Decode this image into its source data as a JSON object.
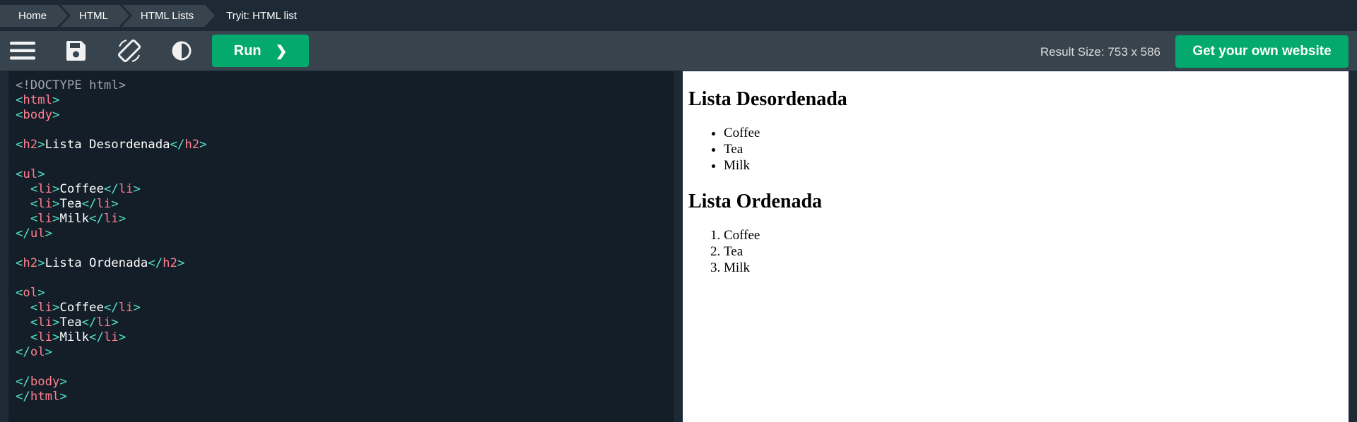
{
  "breadcrumb": {
    "items": [
      "Home",
      "HTML",
      "HTML Lists"
    ],
    "current": "Tryit: HTML list"
  },
  "toolbar": {
    "menu_icon": "hamburger-menu-icon",
    "save_icon": "floppy-disk-icon",
    "rotate_icon": "rotate-orientation-icon",
    "theme_icon": "contrast-icon",
    "run_label": "Run",
    "run_chevron": "❯",
    "result_size": "Result Size: 753 x 586",
    "get_website_label": "Get your own website"
  },
  "colors": {
    "background": "#1d2a35",
    "toolbar": "#38444d",
    "accent_green": "#04aa6d",
    "code_bg": "#141e28",
    "code_punct": "#52e5c6",
    "code_tag": "#ff7f8f"
  },
  "code": {
    "lines": [
      [
        {
          "t": "doct",
          "v": "<!DOCTYPE html>"
        }
      ],
      [
        {
          "t": "punc",
          "v": "<"
        },
        {
          "t": "tag",
          "v": "html"
        },
        {
          "t": "punc",
          "v": ">"
        }
      ],
      [
        {
          "t": "punc",
          "v": "<"
        },
        {
          "t": "tag",
          "v": "body"
        },
        {
          "t": "punc",
          "v": ">"
        }
      ],
      [],
      [
        {
          "t": "punc",
          "v": "<"
        },
        {
          "t": "tag",
          "v": "h2"
        },
        {
          "t": "punc",
          "v": ">"
        },
        {
          "t": "text",
          "v": "Lista Desordenada"
        },
        {
          "t": "punc",
          "v": "</"
        },
        {
          "t": "tag",
          "v": "h2"
        },
        {
          "t": "punc",
          "v": ">"
        }
      ],
      [],
      [
        {
          "t": "punc",
          "v": "<"
        },
        {
          "t": "tag",
          "v": "ul"
        },
        {
          "t": "punc",
          "v": ">"
        }
      ],
      [
        {
          "t": "text",
          "v": "  "
        },
        {
          "t": "punc",
          "v": "<"
        },
        {
          "t": "tag",
          "v": "li"
        },
        {
          "t": "punc",
          "v": ">"
        },
        {
          "t": "text",
          "v": "Coffee"
        },
        {
          "t": "punc",
          "v": "</"
        },
        {
          "t": "tag",
          "v": "li"
        },
        {
          "t": "punc",
          "v": ">"
        }
      ],
      [
        {
          "t": "text",
          "v": "  "
        },
        {
          "t": "punc",
          "v": "<"
        },
        {
          "t": "tag",
          "v": "li"
        },
        {
          "t": "punc",
          "v": ">"
        },
        {
          "t": "text",
          "v": "Tea"
        },
        {
          "t": "punc",
          "v": "</"
        },
        {
          "t": "tag",
          "v": "li"
        },
        {
          "t": "punc",
          "v": ">"
        }
      ],
      [
        {
          "t": "text",
          "v": "  "
        },
        {
          "t": "punc",
          "v": "<"
        },
        {
          "t": "tag",
          "v": "li"
        },
        {
          "t": "punc",
          "v": ">"
        },
        {
          "t": "text",
          "v": "Milk"
        },
        {
          "t": "punc",
          "v": "</"
        },
        {
          "t": "tag",
          "v": "li"
        },
        {
          "t": "punc",
          "v": ">"
        }
      ],
      [
        {
          "t": "punc",
          "v": "</"
        },
        {
          "t": "tag",
          "v": "ul"
        },
        {
          "t": "punc",
          "v": ">"
        }
      ],
      [],
      [
        {
          "t": "punc",
          "v": "<"
        },
        {
          "t": "tag",
          "v": "h2"
        },
        {
          "t": "punc",
          "v": ">"
        },
        {
          "t": "text",
          "v": "Lista Ordenada"
        },
        {
          "t": "punc",
          "v": "</"
        },
        {
          "t": "tag",
          "v": "h2"
        },
        {
          "t": "punc",
          "v": ">"
        }
      ],
      [],
      [
        {
          "t": "punc",
          "v": "<"
        },
        {
          "t": "tag",
          "v": "ol"
        },
        {
          "t": "punc",
          "v": ">"
        }
      ],
      [
        {
          "t": "text",
          "v": "  "
        },
        {
          "t": "punc",
          "v": "<"
        },
        {
          "t": "tag",
          "v": "li"
        },
        {
          "t": "punc",
          "v": ">"
        },
        {
          "t": "text",
          "v": "Coffee"
        },
        {
          "t": "punc",
          "v": "</"
        },
        {
          "t": "tag",
          "v": "li"
        },
        {
          "t": "punc",
          "v": ">"
        }
      ],
      [
        {
          "t": "text",
          "v": "  "
        },
        {
          "t": "punc",
          "v": "<"
        },
        {
          "t": "tag",
          "v": "li"
        },
        {
          "t": "punc",
          "v": ">"
        },
        {
          "t": "text",
          "v": "Tea"
        },
        {
          "t": "punc",
          "v": "</"
        },
        {
          "t": "tag",
          "v": "li"
        },
        {
          "t": "punc",
          "v": ">"
        }
      ],
      [
        {
          "t": "text",
          "v": "  "
        },
        {
          "t": "punc",
          "v": "<"
        },
        {
          "t": "tag",
          "v": "li"
        },
        {
          "t": "punc",
          "v": ">"
        },
        {
          "t": "text",
          "v": "Milk"
        },
        {
          "t": "punc",
          "v": "</"
        },
        {
          "t": "tag",
          "v": "li"
        },
        {
          "t": "punc",
          "v": ">"
        }
      ],
      [
        {
          "t": "punc",
          "v": "</"
        },
        {
          "t": "tag",
          "v": "ol"
        },
        {
          "t": "punc",
          "v": ">"
        }
      ],
      [],
      [
        {
          "t": "punc",
          "v": "</"
        },
        {
          "t": "tag",
          "v": "body"
        },
        {
          "t": "punc",
          "v": ">"
        }
      ],
      [
        {
          "t": "punc",
          "v": "</"
        },
        {
          "t": "tag",
          "v": "html"
        },
        {
          "t": "punc",
          "v": ">"
        }
      ]
    ]
  },
  "result": {
    "heading_unordered": "Lista Desordenada",
    "unordered_items": [
      "Coffee",
      "Tea",
      "Milk"
    ],
    "heading_ordered": "Lista Ordenada",
    "ordered_items": [
      "Coffee",
      "Tea",
      "Milk"
    ]
  }
}
